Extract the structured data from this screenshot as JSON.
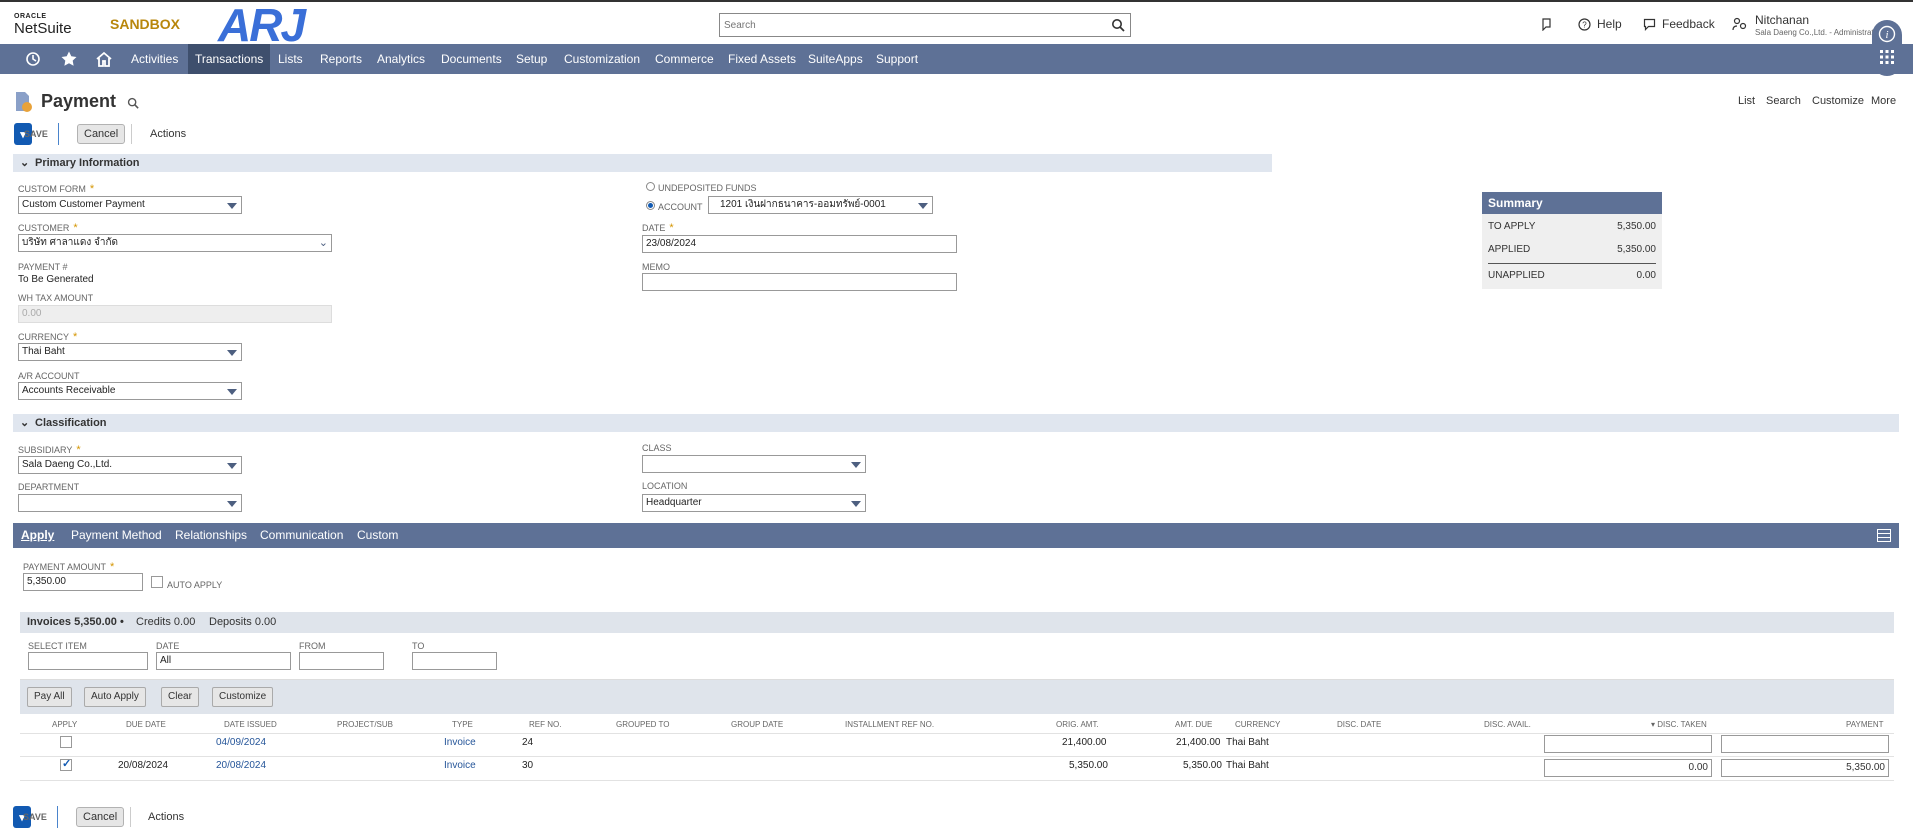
{
  "header": {
    "oracle": "ORACLE",
    "netsuite": "NetSuite",
    "sandbox": "SANDBOX",
    "company_logo": "ARJ",
    "search_placeholder": "Search",
    "help": "Help",
    "feedback": "Feedback",
    "user_name": "Nitchanan",
    "user_role": "Sala Daeng Co.,Ltd. - Administrator"
  },
  "nav": {
    "items": [
      "Activities",
      "Transactions",
      "Lists",
      "Reports",
      "Analytics",
      "Documents",
      "Setup",
      "Customization",
      "Commerce",
      "Fixed Assets",
      "SuiteApps",
      "Support"
    ],
    "active": "Transactions"
  },
  "page": {
    "title": "Payment",
    "links": [
      "List",
      "Search",
      "Customize",
      "More"
    ],
    "save": "Save",
    "cancel": "Cancel",
    "actions": "Actions"
  },
  "primary": {
    "section_title": "Primary Information",
    "custom_form_label": "CUSTOM FORM",
    "custom_form_value": "Custom Customer Payment",
    "customer_label": "CUSTOMER",
    "customer_value": "บริษัท ศาลาแดง จำกัด",
    "payment_no_label": "PAYMENT #",
    "payment_no_value": "To Be Generated",
    "wh_tax_label": "WH TAX AMOUNT",
    "wh_tax_value": "0.00",
    "currency_label": "CURRENCY",
    "currency_value": "Thai Baht",
    "ar_account_label": "A/R ACCOUNT",
    "ar_account_value": "Accounts Receivable",
    "undeposited_label": "UNDEPOSITED FUNDS",
    "account_label": "ACCOUNT",
    "account_value": "1201 เงินฝากธนาคาร-ออมทรัพย์-0001",
    "date_label": "DATE",
    "date_value": "23/08/2024",
    "memo_label": "MEMO",
    "memo_value": ""
  },
  "summary": {
    "title": "Summary",
    "to_apply_label": "TO APPLY",
    "to_apply_value": "5,350.00",
    "applied_label": "APPLIED",
    "applied_value": "5,350.00",
    "unapplied_label": "UNAPPLIED",
    "unapplied_value": "0.00"
  },
  "classification": {
    "section_title": "Classification",
    "subsidiary_label": "SUBSIDIARY",
    "subsidiary_value": "Sala Daeng Co.,Ltd.",
    "department_label": "DEPARTMENT",
    "department_value": "",
    "class_label": "CLASS",
    "class_value": "",
    "location_label": "LOCATION",
    "location_value": "Headquarter"
  },
  "tabs": [
    "Apply",
    "Payment Method",
    "Relationships",
    "Communication",
    "Custom"
  ],
  "apply": {
    "payment_amount_label": "PAYMENT AMOUNT",
    "payment_amount_value": "5,350.00",
    "auto_apply_label": "AUTO APPLY",
    "sublist_tabs": [
      "Invoices 5,350.00 •",
      "Credits 0.00",
      "Deposits 0.00"
    ],
    "filter_select_item": "SELECT ITEM",
    "filter_date": "DATE",
    "filter_date_value": "All",
    "filter_from": "FROM",
    "filter_to": "TO",
    "buttons": [
      "Pay All",
      "Auto Apply",
      "Clear",
      "Customize"
    ],
    "columns": [
      "APPLY",
      "DUE DATE",
      "DATE ISSUED",
      "PROJECT/SUB",
      "TYPE",
      "REF NO.",
      "GROUPED TO",
      "GROUP DATE",
      "INSTALLMENT REF NO.",
      "ORIG. AMT.",
      "AMT. DUE",
      "CURRENCY",
      "DISC. DATE",
      "DISC. AVAIL.",
      "▾ DISC. TAKEN",
      "PAYMENT"
    ],
    "rows": [
      {
        "due_date": "",
        "date_issued": "04/09/2024",
        "type": "Invoice",
        "ref_no": "24",
        "orig_amt": "21,400.00",
        "amt_due": "21,400.00",
        "currency": "Thai Baht",
        "disc_taken": "",
        "payment": ""
      },
      {
        "due_date": "20/08/2024",
        "date_issued": "20/08/2024",
        "type": "Invoice",
        "ref_no": "30",
        "orig_amt": "5,350.00",
        "amt_due": "5,350.00",
        "currency": "Thai Baht",
        "disc_taken": "0.00",
        "payment": "5,350.00"
      }
    ]
  }
}
